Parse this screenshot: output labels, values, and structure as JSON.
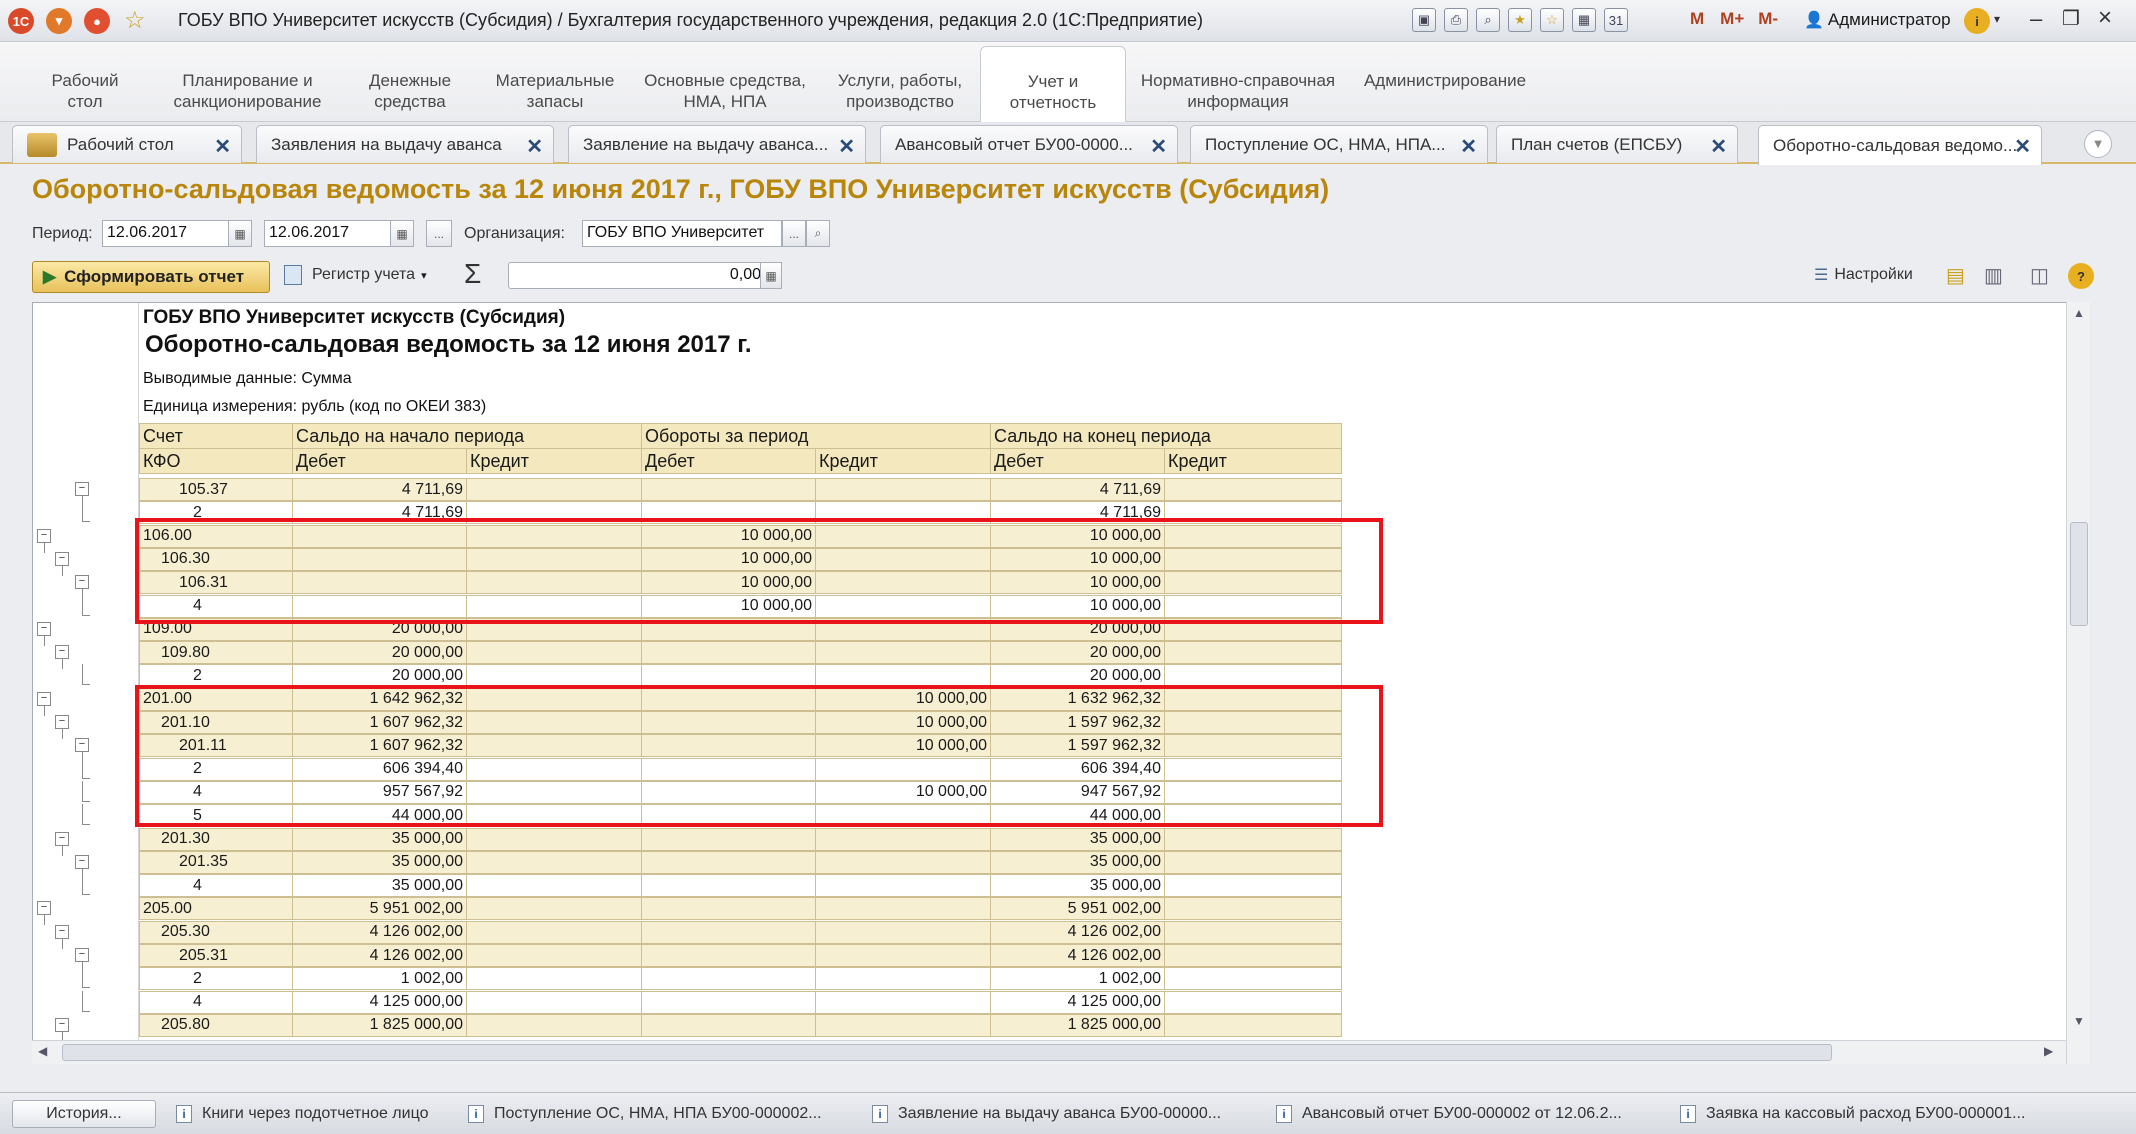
{
  "window": {
    "title": "ГОБУ ВПО Университет искусств (Субсидия) / Бухгалтерия государственного учреждения, редакция 2.0  (1С:Предприятие)",
    "user": "Администратор",
    "m_buttons": [
      "M",
      "M+",
      "M-"
    ]
  },
  "sections": [
    "Рабочий стол",
    "Планирование и санкционирование",
    "Денежные средства",
    "Материальные запасы",
    "Основные средства, НМА, НПА",
    "Услуги, работы, производство",
    "Учет и отчетность",
    "Нормативно-справочная информация",
    "Администрирование"
  ],
  "sections_lines": [
    [
      "Рабочий",
      "стол"
    ],
    [
      "Планирование и",
      "санкционирование"
    ],
    [
      "Денежные",
      "средства"
    ],
    [
      "Материальные",
      "запасы"
    ],
    [
      "Основные средства,",
      "НМА, НПА"
    ],
    [
      "Услуги, работы,",
      "производство"
    ],
    [
      "Учет и",
      "отчетность"
    ],
    [
      "Нормативно-справочная",
      "информация"
    ],
    [
      "Администрирование",
      ""
    ]
  ],
  "tabs": [
    "Рабочий стол",
    "Заявления на выдачу аванса",
    "Заявление на выдачу аванса...",
    "Авансовый отчет БУ00-0000...",
    "Поступление ОС, НМА, НПА...",
    "План счетов (ЕПСБУ)",
    "Оборотно-сальдовая ведомо..."
  ],
  "report_title": "Оборотно-сальдовая ведомость за 12 июня 2017 г., ГОБУ ВПО Университет искусств (Субсидия)",
  "form": {
    "period_label": "Период:",
    "date_from": "12.06.2017",
    "date_to": "12.06.2017",
    "org_label": "Организация:",
    "org_value": "ГОБУ ВПО Университет",
    "sum_value": "0,00",
    "dots": "..."
  },
  "toolbar": {
    "generate": "Сформировать отчет",
    "register": "Регистр учета",
    "settings": "Настройки",
    "sigma": "Σ"
  },
  "report": {
    "org": "ГОБУ ВПО Университет искусств (Субсидия)",
    "heading": "Оборотно-сальдовая ведомость за 12 июня 2017 г.",
    "output_data": "Выводимые данные:  Сумма",
    "unit": "Единица измерения: рубль (код по ОКЕИ 383)"
  },
  "table": {
    "header1": [
      "Счет",
      "Сальдо на начало периода",
      "Обороты за период",
      "Сальдо на конец периода"
    ],
    "header2": [
      "КФО",
      "Дебет",
      "Кредит",
      "Дебет",
      "Кредит",
      "Дебет",
      "Кредит"
    ],
    "rows": [
      {
        "acc": "105.37",
        "lvl": 2,
        "d0": "4 711,69",
        "c0": "",
        "d1": "",
        "c1": "",
        "d2": "4 711,69",
        "c2": ""
      },
      {
        "acc": "2",
        "lvl": 3,
        "d0": "4 711,69",
        "c0": "",
        "d1": "",
        "c1": "",
        "d2": "4 711,69",
        "c2": ""
      },
      {
        "acc": "106.00",
        "lvl": 0,
        "d0": "",
        "c0": "",
        "d1": "10 000,00",
        "c1": "",
        "d2": "10 000,00",
        "c2": ""
      },
      {
        "acc": "106.30",
        "lvl": 1,
        "d0": "",
        "c0": "",
        "d1": "10 000,00",
        "c1": "",
        "d2": "10 000,00",
        "c2": ""
      },
      {
        "acc": "106.31",
        "lvl": 2,
        "d0": "",
        "c0": "",
        "d1": "10 000,00",
        "c1": "",
        "d2": "10 000,00",
        "c2": ""
      },
      {
        "acc": "4",
        "lvl": 3,
        "d0": "",
        "c0": "",
        "d1": "10 000,00",
        "c1": "",
        "d2": "10 000,00",
        "c2": ""
      },
      {
        "acc": "109.00",
        "lvl": 0,
        "d0": "20 000,00",
        "c0": "",
        "d1": "",
        "c1": "",
        "d2": "20 000,00",
        "c2": ""
      },
      {
        "acc": "109.80",
        "lvl": 1,
        "d0": "20 000,00",
        "c0": "",
        "d1": "",
        "c1": "",
        "d2": "20 000,00",
        "c2": ""
      },
      {
        "acc": "2",
        "lvl": 3,
        "d0": "20 000,00",
        "c0": "",
        "d1": "",
        "c1": "",
        "d2": "20 000,00",
        "c2": ""
      },
      {
        "acc": "201.00",
        "lvl": 0,
        "d0": "1 642 962,32",
        "c0": "",
        "d1": "",
        "c1": "10 000,00",
        "d2": "1 632 962,32",
        "c2": ""
      },
      {
        "acc": "201.10",
        "lvl": 1,
        "d0": "1 607 962,32",
        "c0": "",
        "d1": "",
        "c1": "10 000,00",
        "d2": "1 597 962,32",
        "c2": ""
      },
      {
        "acc": "201.11",
        "lvl": 2,
        "d0": "1 607 962,32",
        "c0": "",
        "d1": "",
        "c1": "10 000,00",
        "d2": "1 597 962,32",
        "c2": ""
      },
      {
        "acc": "2",
        "lvl": 3,
        "d0": "606 394,40",
        "c0": "",
        "d1": "",
        "c1": "",
        "d2": "606 394,40",
        "c2": ""
      },
      {
        "acc": "4",
        "lvl": 3,
        "d0": "957 567,92",
        "c0": "",
        "d1": "",
        "c1": "10 000,00",
        "d2": "947 567,92",
        "c2": ""
      },
      {
        "acc": "5",
        "lvl": 3,
        "d0": "44 000,00",
        "c0": "",
        "d1": "",
        "c1": "",
        "d2": "44 000,00",
        "c2": ""
      },
      {
        "acc": "201.30",
        "lvl": 1,
        "d0": "35 000,00",
        "c0": "",
        "d1": "",
        "c1": "",
        "d2": "35 000,00",
        "c2": ""
      },
      {
        "acc": "201.35",
        "lvl": 2,
        "d0": "35 000,00",
        "c0": "",
        "d1": "",
        "c1": "",
        "d2": "35 000,00",
        "c2": ""
      },
      {
        "acc": "4",
        "lvl": 3,
        "d0": "35 000,00",
        "c0": "",
        "d1": "",
        "c1": "",
        "d2": "35 000,00",
        "c2": ""
      },
      {
        "acc": "205.00",
        "lvl": 0,
        "d0": "5 951 002,00",
        "c0": "",
        "d1": "",
        "c1": "",
        "d2": "5 951 002,00",
        "c2": ""
      },
      {
        "acc": "205.30",
        "lvl": 1,
        "d0": "4 126 002,00",
        "c0": "",
        "d1": "",
        "c1": "",
        "d2": "4 126 002,00",
        "c2": ""
      },
      {
        "acc": "205.31",
        "lvl": 2,
        "d0": "4 126 002,00",
        "c0": "",
        "d1": "",
        "c1": "",
        "d2": "4 126 002,00",
        "c2": ""
      },
      {
        "acc": "2",
        "lvl": 3,
        "d0": "1 002,00",
        "c0": "",
        "d1": "",
        "c1": "",
        "d2": "1 002,00",
        "c2": ""
      },
      {
        "acc": "4",
        "lvl": 3,
        "d0": "4 125 000,00",
        "c0": "",
        "d1": "",
        "c1": "",
        "d2": "4 125 000,00",
        "c2": ""
      },
      {
        "acc": "205.80",
        "lvl": 1,
        "d0": "1 825 000,00",
        "c0": "",
        "d1": "",
        "c1": "",
        "d2": "1 825 000,00",
        "c2": ""
      }
    ]
  },
  "statusbar": {
    "history": "История...",
    "items": [
      "Книги через подотчетное лицо",
      "Поступление ОС, НМА, НПА БУ00-000002...",
      "Заявление на выдачу аванса БУ00-00000...",
      "Авансовый отчет БУ00-000002 от 12.06.2...",
      "Заявка на кассовый расход БУ00-000001..."
    ]
  },
  "colors": {
    "title_gold": "#b8860b",
    "table_header": "#f4e8be",
    "highlight_red": "#e8141a",
    "generate_button": "#e8c15a"
  }
}
